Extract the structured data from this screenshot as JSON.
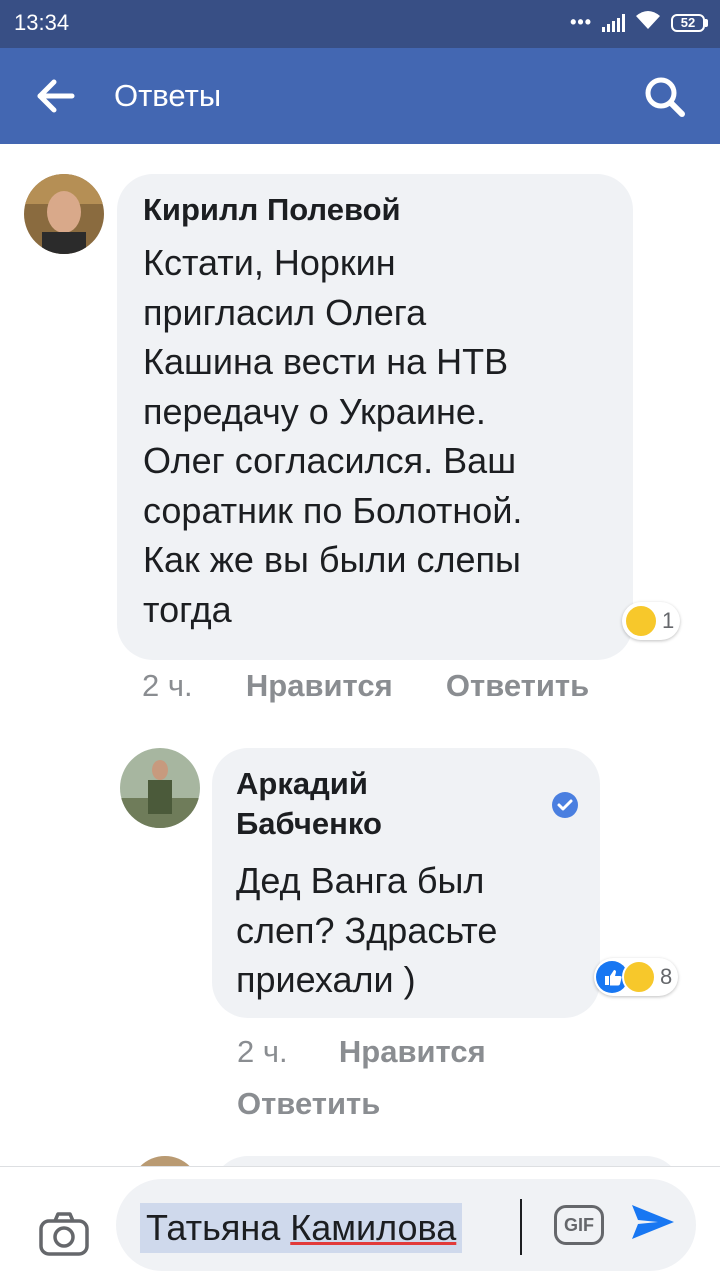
{
  "status_bar": {
    "time": "13:34",
    "battery": "52"
  },
  "app_bar": {
    "title": "Ответы"
  },
  "comments": [
    {
      "author": "Кирилл Полевой",
      "text_lines": [
        "Кстати, Норкин",
        "пригласил Олега",
        "Кашина вести на НТВ",
        "передачу о Украине.",
        "Олег согласился. Ваш",
        "соратник по Болотной.",
        "Как же вы были слепы",
        "тогда"
      ],
      "reaction_count": "1",
      "reactions": [
        "haha-icon"
      ],
      "time": "2 ч.",
      "like_label": "Нравится",
      "reply_label": "Ответить"
    },
    {
      "author_lines": [
        "Аркадий",
        "Бабченко"
      ],
      "verified": true,
      "text_lines": [
        "Дед Ванга был",
        "слеп? Здрасьте",
        "приехали )"
      ],
      "reaction_count": "8",
      "reactions": [
        "like-icon",
        "haha-icon"
      ],
      "time": "2 ч.",
      "like_label": "Нравится",
      "reply_label": "Ответить"
    }
  ],
  "composer": {
    "first_name": "Татьяна",
    "last_name": "Камилова",
    "gif_label": "GIF"
  },
  "colors": {
    "status_bar": "#384f85",
    "app_bar": "#4367b2",
    "bubble": "#f0f2f5",
    "meta_text": "#8a8d91",
    "send": "#1877f2"
  }
}
